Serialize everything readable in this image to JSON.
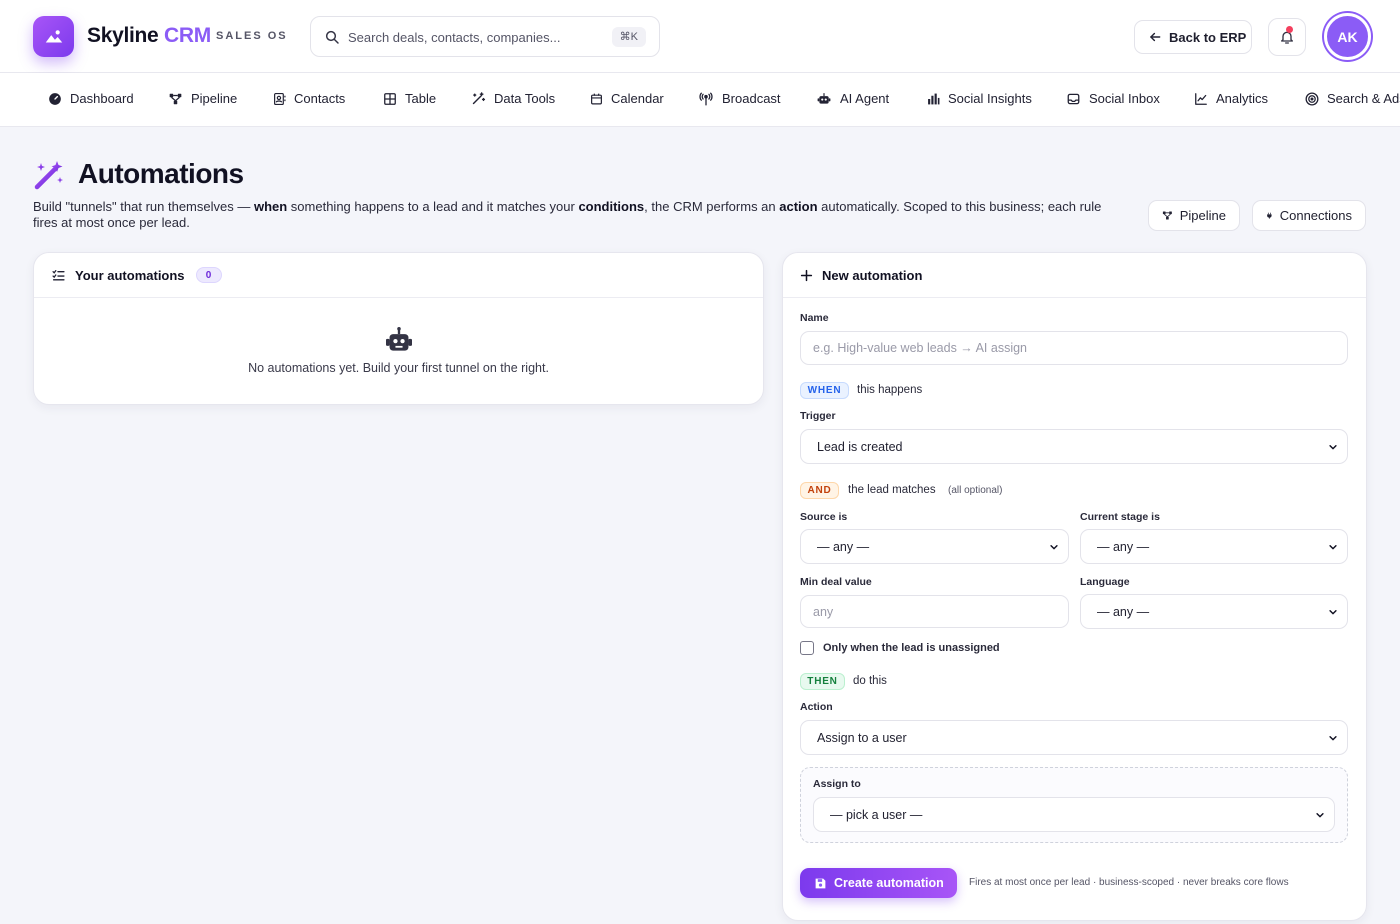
{
  "header": {
    "brand_name": "Skyline",
    "brand_accent": "CRM",
    "brand_sub": "SALES OS",
    "search_placeholder": "Search deals, contacts, companies...",
    "search_shortcut": "⌘K",
    "back_label": "Back to ERP",
    "avatar_initials": "AK",
    "has_notification": true
  },
  "nav": {
    "items": [
      {
        "label": "Dashboard",
        "icon": "dashboard-icon"
      },
      {
        "label": "Pipeline",
        "icon": "pipeline-icon"
      },
      {
        "label": "Contacts",
        "icon": "contacts-icon"
      },
      {
        "label": "Table",
        "icon": "table-icon"
      },
      {
        "label": "Data Tools",
        "icon": "magic-wand-icon"
      },
      {
        "label": "Calendar",
        "icon": "calendar-icon"
      },
      {
        "label": "Broadcast",
        "icon": "broadcast-icon"
      },
      {
        "label": "AI Agent",
        "icon": "robot-icon"
      },
      {
        "label": "Social Insights",
        "icon": "bar-chart-icon"
      },
      {
        "label": "Social Inbox",
        "icon": "inbox-icon"
      },
      {
        "label": "Analytics",
        "icon": "line-chart-icon"
      },
      {
        "label": "Search & Ads",
        "icon": "target-icon"
      }
    ]
  },
  "page": {
    "title": "Automations",
    "desc_1": "Build \"tunnels\" that run themselves — ",
    "desc_when": "when",
    "desc_2": " something happens to a lead and it matches your ",
    "desc_conditions": "conditions",
    "desc_3": ", the CRM performs an ",
    "desc_action": "action",
    "desc_4": " automatically. Scoped to this business; each rule fires at most once per lead.",
    "pipeline_btn": "Pipeline",
    "connections_btn": "Connections"
  },
  "automations_list": {
    "title": "Your automations",
    "count": "0",
    "empty_text": "No automations yet. Build your first tunnel on the right."
  },
  "form": {
    "title": "New automation",
    "name_label": "Name",
    "name_placeholder": "e.g. High-value web leads → AI assign",
    "when_tag": "WHEN",
    "when_text": "this happens",
    "trigger_label": "Trigger",
    "trigger_value": "Lead is created",
    "and_tag": "AND",
    "and_text": "the lead matches",
    "and_note": "(all optional)",
    "source_label": "Source is",
    "source_value": "— any —",
    "stage_label": "Current stage is",
    "stage_value": "— any —",
    "min_value_label": "Min deal value",
    "min_value_placeholder": "any",
    "language_label": "Language",
    "language_value": "— any —",
    "unassigned_label": "Only when the lead is unassigned",
    "then_tag": "THEN",
    "then_text": "do this",
    "action_label": "Action",
    "action_value": "Assign to a user",
    "assign_label": "Assign to",
    "assign_value": "— pick a user —",
    "create_btn": "Create automation",
    "footnote": "Fires at most once per lead · business-scoped · never breaks core flows"
  },
  "colors": {
    "accent": "#8b5cf6",
    "when": "#2563eb",
    "and": "#c2410c",
    "then": "#15803d"
  }
}
